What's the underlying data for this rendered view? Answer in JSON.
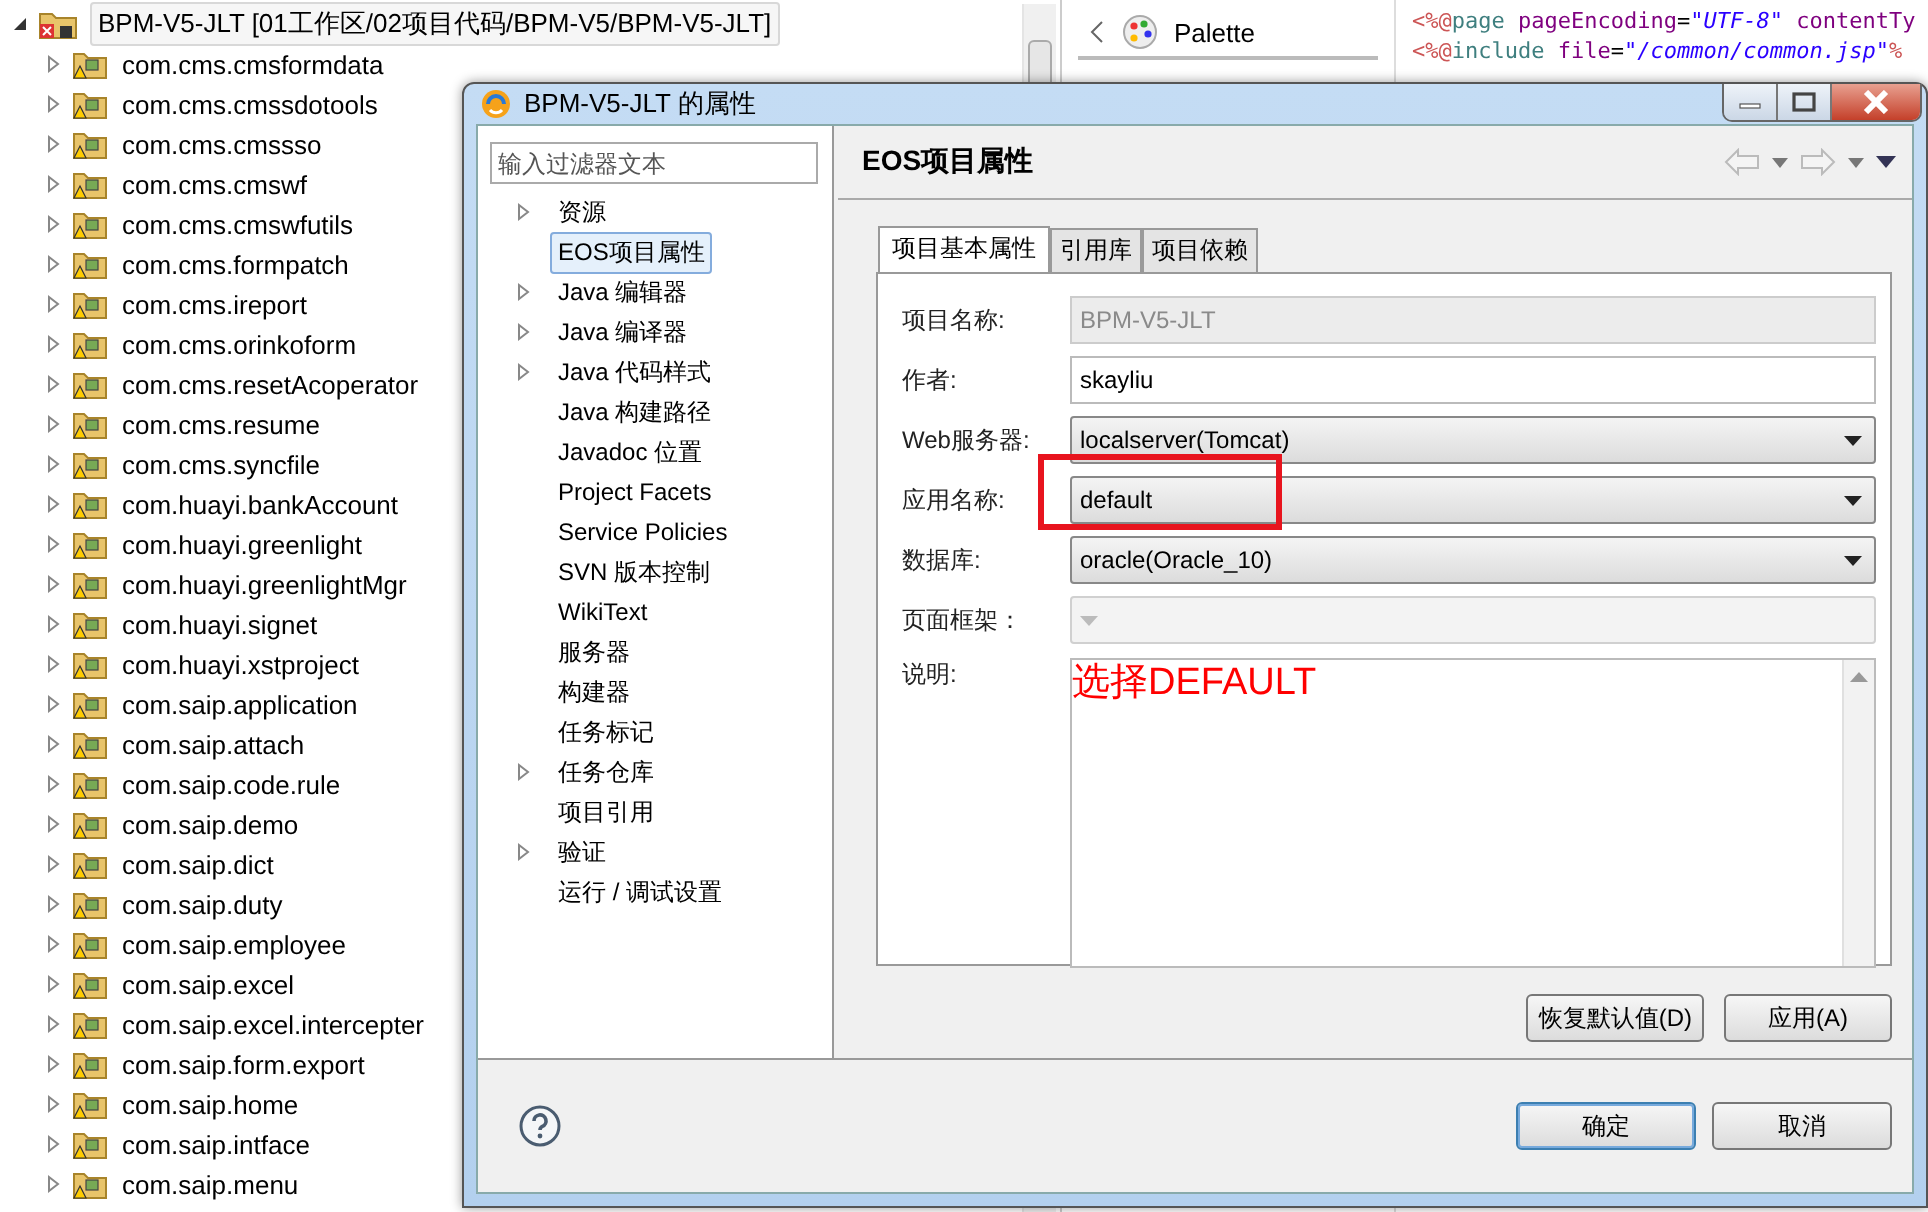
{
  "explorer": {
    "root": {
      "label": "BPM-V5-JLT [01工作区/02项目代码/BPM-V5/BPM-V5-JLT]",
      "expanded": true,
      "selected": true,
      "children": [
        {
          "label": "com.cms.cmsformdata",
          "expanded": false
        },
        {
          "label": "com.cms.cmssdotools",
          "expanded": false
        },
        {
          "label": "com.cms.cmssso",
          "expanded": false
        },
        {
          "label": "com.cms.cmswf",
          "expanded": false
        },
        {
          "label": "com.cms.cmswfutils",
          "expanded": false
        },
        {
          "label": "com.cms.formpatch",
          "expanded": false
        },
        {
          "label": "com.cms.ireport",
          "expanded": false
        },
        {
          "label": "com.cms.orinkoform",
          "expanded": false
        },
        {
          "label": "com.cms.resetAcoperator",
          "expanded": false
        },
        {
          "label": "com.cms.resume",
          "expanded": false
        },
        {
          "label": "com.cms.syncfile",
          "expanded": false
        },
        {
          "label": "com.huayi.bankAccount",
          "expanded": false
        },
        {
          "label": "com.huayi.greenlight",
          "expanded": false
        },
        {
          "label": "com.huayi.greenlightMgr",
          "expanded": false
        },
        {
          "label": "com.huayi.signet",
          "expanded": false
        },
        {
          "label": "com.huayi.xstproject",
          "expanded": false
        },
        {
          "label": "com.saip.application",
          "expanded": false
        },
        {
          "label": "com.saip.attach",
          "expanded": false
        },
        {
          "label": "com.saip.code.rule",
          "expanded": false
        },
        {
          "label": "com.saip.demo",
          "expanded": false
        },
        {
          "label": "com.saip.dict",
          "expanded": false
        },
        {
          "label": "com.saip.duty",
          "expanded": false
        },
        {
          "label": "com.saip.employee",
          "expanded": false
        },
        {
          "label": "com.saip.excel",
          "expanded": false
        },
        {
          "label": "com.saip.excel.intercepter",
          "expanded": false
        },
        {
          "label": "com.saip.form.export",
          "expanded": false
        },
        {
          "label": "com.saip.home",
          "expanded": false
        },
        {
          "label": "com.saip.intface",
          "expanded": false
        },
        {
          "label": "com.saip.menu",
          "expanded": false
        }
      ]
    }
  },
  "palette": {
    "title": "Palette"
  },
  "editor": {
    "lines": [
      [
        {
          "kind": "directive",
          "text": "<%@"
        },
        {
          "kind": "keyword",
          "text": "page "
        },
        {
          "kind": "attr",
          "text": "pageEncoding"
        },
        {
          "kind": "plain",
          "text": "="
        },
        {
          "kind": "string",
          "text": "\"UTF-8\""
        },
        {
          "kind": "attr",
          "text": " contentTy"
        }
      ],
      [
        {
          "kind": "directive",
          "text": "<%@"
        },
        {
          "kind": "keyword",
          "text": "include "
        },
        {
          "kind": "attr",
          "text": "file"
        },
        {
          "kind": "plain",
          "text": "="
        },
        {
          "kind": "string",
          "text": "\"/common/common.jsp\""
        },
        {
          "kind": "directive",
          "text": "%"
        }
      ]
    ]
  },
  "dialog": {
    "title": "BPM-V5-JLT 的属性",
    "filter": {
      "placeholder": "输入过滤器文本"
    },
    "nav": [
      {
        "label": "资源",
        "expandable": true,
        "selected": false
      },
      {
        "label": "EOS项目属性",
        "expandable": false,
        "selected": true
      },
      {
        "label": "Java 编辑器",
        "expandable": true,
        "selected": false
      },
      {
        "label": "Java 编译器",
        "expandable": true,
        "selected": false
      },
      {
        "label": "Java 代码样式",
        "expandable": true,
        "selected": false
      },
      {
        "label": "Java 构建路径",
        "expandable": false,
        "selected": false
      },
      {
        "label": "Javadoc 位置",
        "expandable": false,
        "selected": false
      },
      {
        "label": "Project Facets",
        "expandable": false,
        "selected": false
      },
      {
        "label": "Service Policies",
        "expandable": false,
        "selected": false
      },
      {
        "label": "SVN 版本控制",
        "expandable": false,
        "selected": false
      },
      {
        "label": "WikiText",
        "expandable": false,
        "selected": false
      },
      {
        "label": "服务器",
        "expandable": false,
        "selected": false
      },
      {
        "label": "构建器",
        "expandable": false,
        "selected": false
      },
      {
        "label": "任务标记",
        "expandable": false,
        "selected": false
      },
      {
        "label": "任务仓库",
        "expandable": true,
        "selected": false
      },
      {
        "label": "项目引用",
        "expandable": false,
        "selected": false
      },
      {
        "label": "验证",
        "expandable": true,
        "selected": false
      },
      {
        "label": "运行 / 调试设置",
        "expandable": false,
        "selected": false
      }
    ],
    "page_title": "EOS项目属性",
    "tabs": [
      {
        "label": "项目基本属性",
        "selected": true
      },
      {
        "label": "引用库",
        "selected": false
      },
      {
        "label": "项目依赖",
        "selected": false
      }
    ],
    "fields": [
      {
        "kind": "text",
        "label": "项目名称:",
        "value": "BPM-V5-JLT",
        "disabled": true
      },
      {
        "kind": "text",
        "label": "作者:",
        "value": "skayliu",
        "disabled": false
      },
      {
        "kind": "combo",
        "label": "Web服务器:",
        "value": "localserver(Tomcat)",
        "disabled": false
      },
      {
        "kind": "combo",
        "label": "应用名称:",
        "value": "default",
        "disabled": false,
        "highlighted": true
      },
      {
        "kind": "combo",
        "label": "数据库:",
        "value": "oracle(Oracle_10)",
        "disabled": false
      },
      {
        "kind": "combo",
        "label": "页面框架：",
        "disabled": true
      },
      {
        "kind": "textarea",
        "label": "说明:",
        "annotation": "选择DEFAULT"
      }
    ],
    "page_buttons": [
      "恢复默认值(D)",
      "应用(A)"
    ],
    "buttons": [
      {
        "label": "确定",
        "default": true
      },
      {
        "label": "取消",
        "default": false
      }
    ]
  }
}
